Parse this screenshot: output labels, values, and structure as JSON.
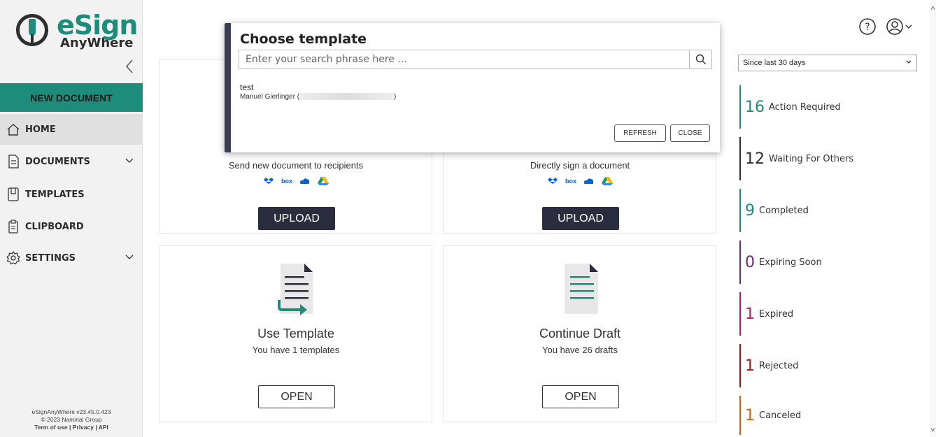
{
  "app": {
    "logo_main": "eSign",
    "logo_sub": "AnyWhere",
    "collapse_glyph": "‹"
  },
  "sidebar": {
    "new_document": "NEW DOCUMENT",
    "items": [
      {
        "label": "HOME",
        "icon": "home-icon",
        "active": true,
        "chevron": false
      },
      {
        "label": "DOCUMENTS",
        "icon": "document-icon",
        "active": false,
        "chevron": true
      },
      {
        "label": "TEMPLATES",
        "icon": "template-icon",
        "active": false,
        "chevron": false
      },
      {
        "label": "CLIPBOARD",
        "icon": "clipboard-icon",
        "active": false,
        "chevron": false
      },
      {
        "label": "SETTINGS",
        "icon": "gear-icon",
        "active": false,
        "chevron": true
      }
    ],
    "footer_version": "eSignAnyWhere v23.45.0.423",
    "footer_copyright": "© 2023 Namirial Group",
    "footer_links": "Term of use | Privacy | API"
  },
  "cards": {
    "send": {
      "subtitle": "Send new document to recipients",
      "button": "UPLOAD"
    },
    "sign": {
      "subtitle": "Directly sign a document",
      "button": "UPLOAD"
    },
    "template": {
      "title": "Use Template",
      "subtitle": "You have 1 templates",
      "button": "OPEN"
    },
    "draft": {
      "title": "Continue Draft",
      "subtitle": "You have 26 drafts",
      "button": "OPEN"
    },
    "cloud_icons": [
      "dropbox-icon",
      "box-icon",
      "onedrive-icon",
      "google-drive-icon"
    ],
    "box_text": "box"
  },
  "modal": {
    "title": "Choose template",
    "search_placeholder": "Enter your search phrase here ...",
    "template_name": "test",
    "template_owner_prefix": "Manuel Gierlinger (",
    "template_owner_suffix": ")",
    "refresh": "REFRESH",
    "close": "CLOSE"
  },
  "stats": {
    "period": "Since last 30 days",
    "items": [
      {
        "count": "16",
        "label": "Action Required",
        "color": "#1e8c7a"
      },
      {
        "count": "12",
        "label": "Waiting For Others",
        "color": "#2e2e2e"
      },
      {
        "count": "9",
        "label": "Completed",
        "color": "#1e8c7a"
      },
      {
        "count": "0",
        "label": "Expiring Soon",
        "color": "#6b2a7a"
      },
      {
        "count": "1",
        "label": "Expired",
        "color": "#c2185b"
      },
      {
        "count": "1",
        "label": "Rejected",
        "color": "#a31515"
      },
      {
        "count": "1",
        "label": "Canceled",
        "color": "#d4620a"
      }
    ]
  },
  "colors": {
    "accent": "#1e8c7a",
    "dark_button": "#2a2d3e"
  }
}
